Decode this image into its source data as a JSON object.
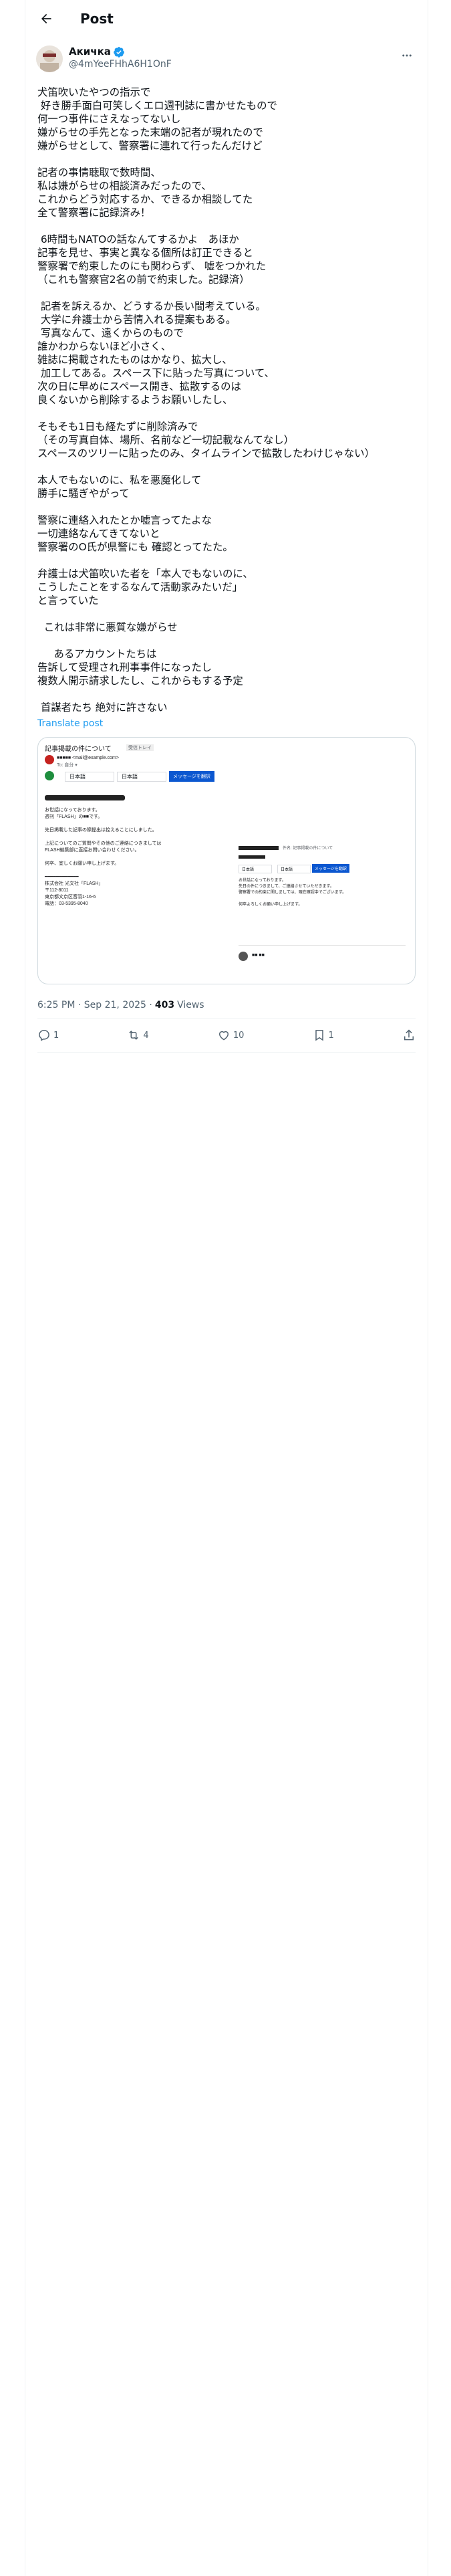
{
  "header": {
    "title": "Post"
  },
  "author": {
    "display_name": "Акичка",
    "handle": "@4mYeeFHhA6H1OnF"
  },
  "tweet": {
    "lines": [
      "犬笛吹いたやつの指示で",
      " 好き勝手面白可笑しくエロ週刊誌に書かせたもので",
      "何一つ事件にさえなってないし",
      "嫌がらせの手先となった末端の記者が現れたので",
      "嫌がらせとして、警察署に連れて行ったんだけど",
      "",
      "記者の事情聴取で数時間、",
      "私は嫌がらせの相談済みだったので、",
      "これからどう対応するか、できるか相談してた",
      "全て警察署に記録済み！",
      "",
      " 6時間もNATOの話なんてするかよ　あほか",
      "記事を見せ、事実と異なる個所は訂正できると",
      "警察署で約束したのにも関わらず、 嘘をつかれた",
      "（これも警察官2名の前で約束した。記録済）",
      "",
      " 記者を訴えるか、どうするか長い間考えている。",
      " 大学に弁護士から苦情入れる提案もある。",
      " 写真なんて、遠くからのもので",
      "誰かわからないほど小さく、",
      "雑誌に掲載されたものはかなり、拡大し、",
      " 加工してある。スペース下に貼った写真について、",
      "次の日に早めにスペース開き、拡散するのは",
      "良くないから削除するようお願いしたし、",
      "",
      "そもそも1日も経たずに削除済みで",
      "（その写真自体、場所、名前など一切記載なんてなし）",
      "スペースのツリーに貼ったのみ、タイムラインで拡散したわけじゃない）",
      "",
      "本人でもないのに、私を悪魔化して",
      "勝手に騒ぎやがって",
      "",
      "警察に連絡入れたとか嘘言ってたよな",
      "一切連絡なんてきてないと",
      "警察署のO氏が県警にも 確認とってたた。",
      "",
      "弁護士は犬笛吹いた者を「本人でもないのに、",
      "こうしたことをするなんて活動家みたいだ」",
      "と言っていた",
      "",
      "  これは非常に悪質な嫌がらせ",
      "",
      "     あるアカウントたちは",
      "告訴して受理され刑事事件になったし",
      "複数人開示請求したし、これからもする予定",
      "",
      " 首謀者たち 絶対に許さない"
    ],
    "translate_label": "Translate post",
    "timestamp": "6:25 PM · Sep 21, 2025 · ",
    "views_count": "403",
    "views_label": "Views"
  },
  "media": {
    "email_subject": "記事掲載の件について",
    "email_tag": "受信トレイ",
    "sender_line": "■■■■■ <mail@example.com>",
    "to_line": "To: 自分 ▾",
    "lang_from": "日本語",
    "lang_to": "日本語",
    "translate_btn": "メッセージを翻訳",
    "body_lines": [
      "お世話になっております。",
      "週刊「FLASH」の■■です。",
      "",
      "先日掲載した記事の際提出は控えることにしました。",
      "",
      "上記についてのご質問やその他のご連絡につきましては",
      "FLASH編集部に直接お問い合わせください。",
      "",
      "何卒、宜しくお願い申し上げます。",
      "",
      "━━━━━━━━━━━━",
      "株式会社 光文社「FLASH」",
      "〒112-8011",
      "東京都文京区音羽1-16-6",
      "電話：03-5395-8040"
    ],
    "right_header": "件名: 記事掲載の件について",
    "right_lines": [
      "お世話になっております。",
      "先日の件につきまして、ご連絡させていただきます。",
      "警察署での約束に関しましては、現在確認中でございます。",
      "",
      "何卒よろしくお願い申し上げます。"
    ],
    "right_signature": "■■ ■■"
  },
  "actions": {
    "replies": "1",
    "reposts": "4",
    "likes": "10",
    "bookmarks": "1"
  },
  "colors": {
    "accent": "#1d9bf0",
    "muted": "#536471",
    "text": "#0f1419",
    "border": "#eff3f4"
  }
}
